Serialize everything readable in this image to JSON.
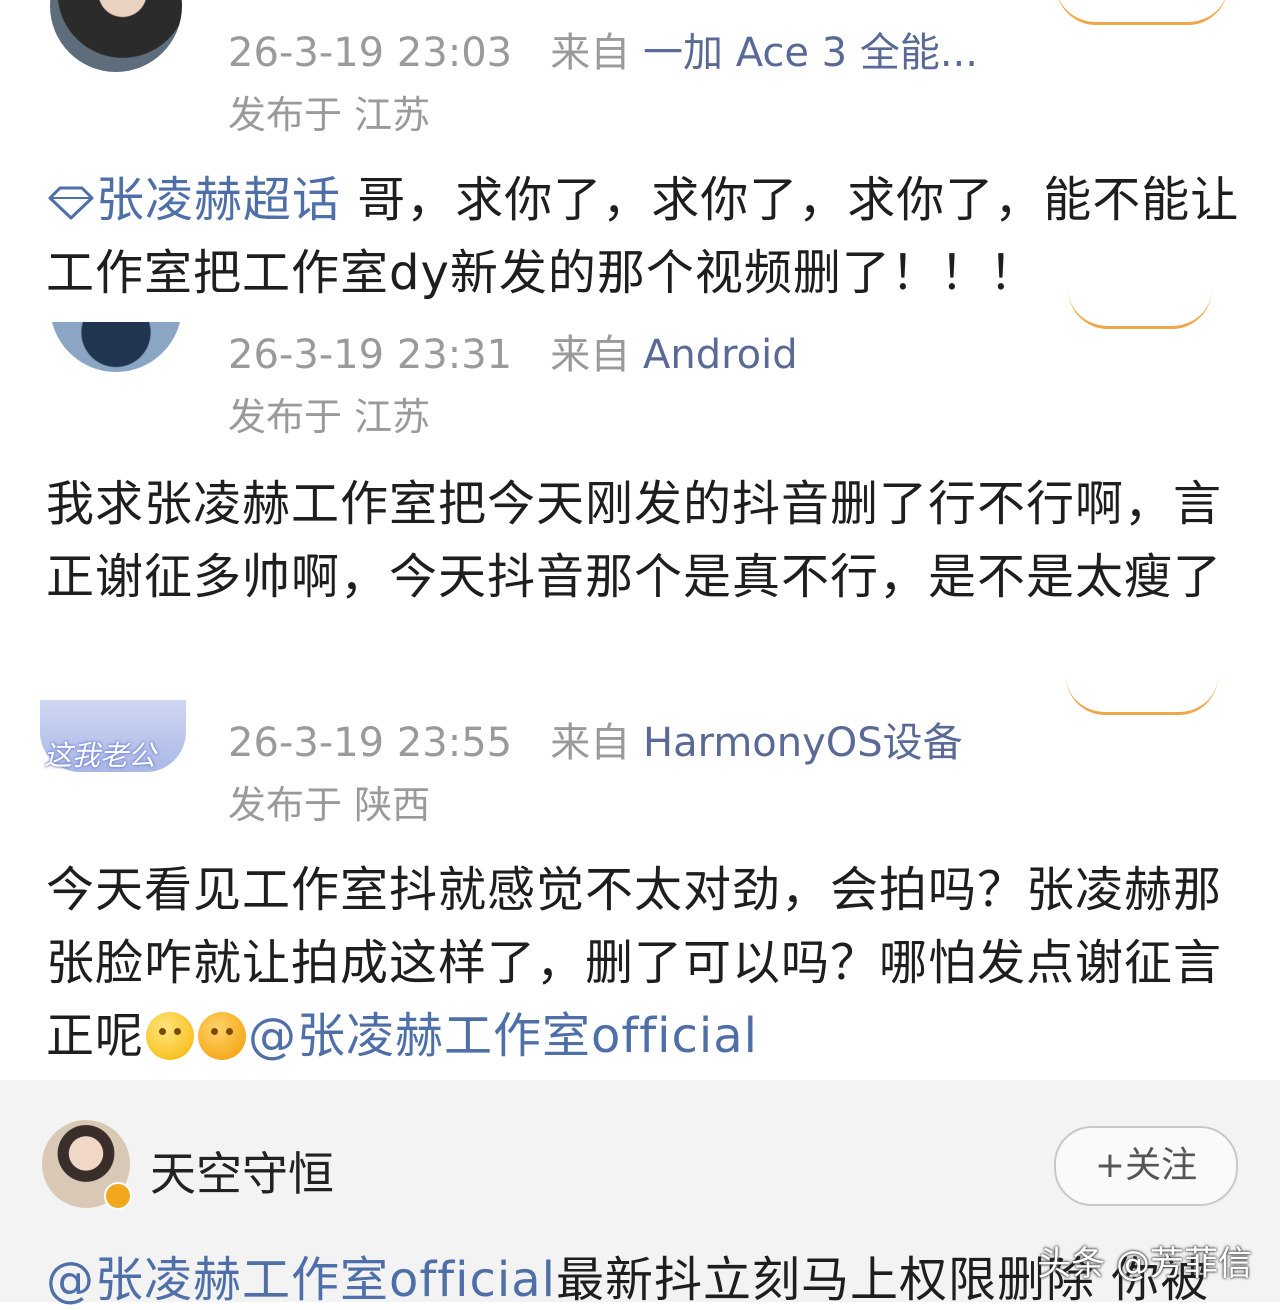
{
  "comments": [
    {
      "time": "26-3-19 23:03",
      "from_label": "来自",
      "source": "一加 Ace 3 全能...",
      "location": "发布于 江苏",
      "topic": "张凌赫超话",
      "text": " 哥，求你了，求你了，求你了，能不能让工作室把工作室dy新发的那个视频删了！！！"
    },
    {
      "time": "26-3-19 23:31",
      "from_label": "来自",
      "source": "Android",
      "location": "发布于 江苏",
      "text": "我求张凌赫工作室把今天刚发的抖音删了行不行啊，言正谢征多帅啊，今天抖音那个是真不行，是不是太瘦了"
    },
    {
      "time": "26-3-19 23:55",
      "from_label": "来自",
      "source": "HarmonyOS设备",
      "location": "发布于 陕西",
      "avatar_caption": "这我老公",
      "text": "今天看见工作室抖就感觉不太对劲，会拍吗？张凌赫那张脸咋就让拍成这样了，删了可以吗？哪怕发点谢征言正呢",
      "mention": "@张凌赫工作室official"
    }
  ],
  "post": {
    "username": "天空守恒",
    "follow_label": "+关注",
    "mention": "@张凌赫工作室official",
    "text": "最新抖立刻马上权限删除 你被"
  },
  "watermark": "头条 @芳菲信"
}
